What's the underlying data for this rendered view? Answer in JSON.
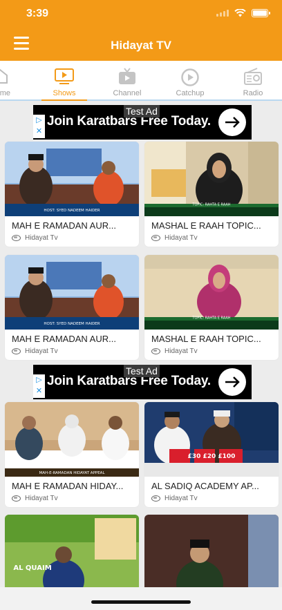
{
  "status_bar": {
    "time": "3:39"
  },
  "header": {
    "title": "Hidayat TV"
  },
  "tabs": [
    {
      "label": "me",
      "icon": "home-icon"
    },
    {
      "label": "Shows",
      "icon": "play-screen-icon"
    },
    {
      "label": "Channel",
      "icon": "tv-icon"
    },
    {
      "label": "Catchup",
      "icon": "replay-icon"
    },
    {
      "label": "Radio",
      "icon": "radio-icon"
    }
  ],
  "ads": [
    {
      "label": "Test Ad",
      "text": "Join Karatbars Free Today."
    },
    {
      "label": "Test Ad",
      "text": "Join Karatbars Free Today."
    }
  ],
  "shows": [
    {
      "title": "MAH E RAMADAN AUR...",
      "channel": "Hidayat Tv",
      "thumb_text": "HOST: SYED NADEEM HAIDER"
    },
    {
      "title": "MASHAL E RAAH TOPIC...",
      "channel": "Hidayat Tv",
      "thumb_text": "TOPIC: RAHTA E RAAH"
    },
    {
      "title": "MAH E RAMADAN AUR...",
      "channel": "Hidayat Tv",
      "thumb_text": "HOST: SYED NADEEM HAIDER"
    },
    {
      "title": "MASHAL E RAAH TOPIC...",
      "channel": "Hidayat Tv",
      "thumb_text": "TOPIC: RAHTA E RAAH"
    },
    {
      "title": "MAH E RAMADAN HIDAY...",
      "channel": "Hidayat Tv",
      "thumb_text": "MAH-E-RAMADAN HIDAYAT APPEAL"
    },
    {
      "title": "AL SADIQ ACADEMY AP...",
      "channel": "Hidayat Tv",
      "thumb_text": "£30  £20  £100"
    },
    {
      "title": "",
      "channel": "",
      "thumb_text": "AL QUAIM"
    },
    {
      "title": "",
      "channel": "",
      "thumb_text": ""
    }
  ],
  "colors": {
    "brand": "#F39A17",
    "active_tab": "#F39A17",
    "inactive_tab": "#9a9a9a"
  }
}
